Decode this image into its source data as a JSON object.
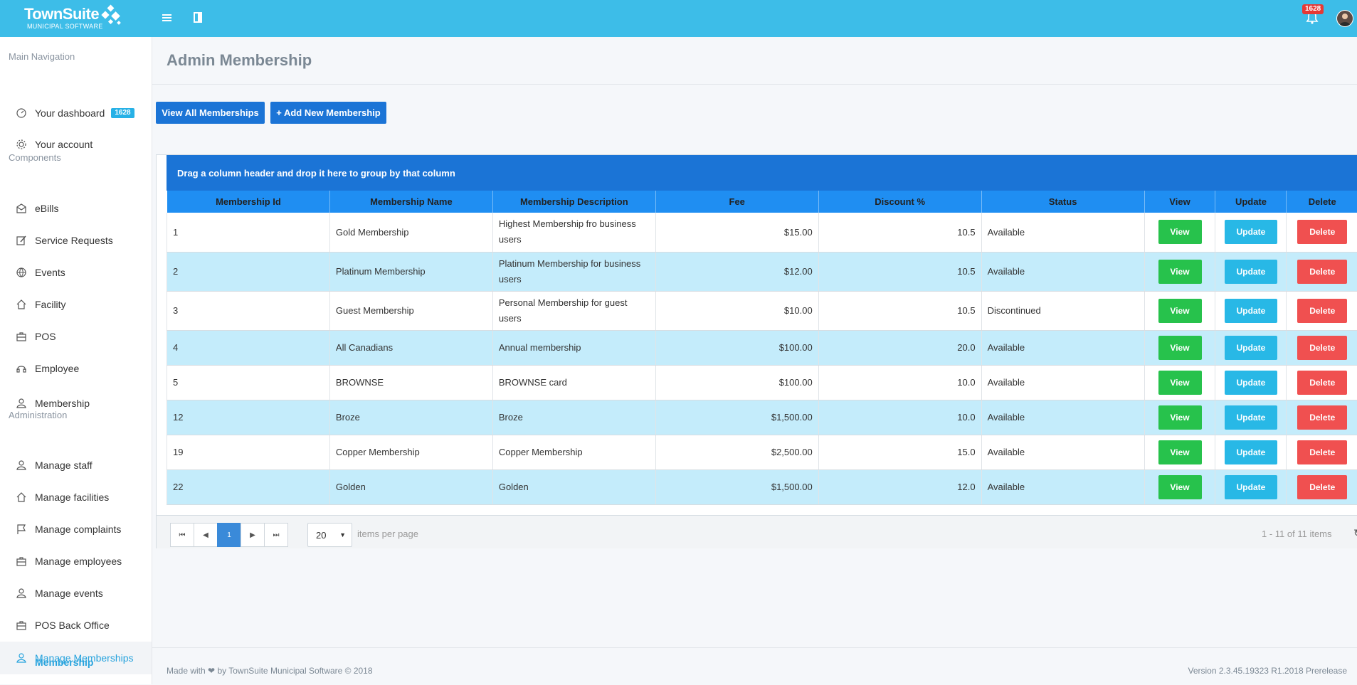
{
  "app": {
    "logo_name": "TownSuite",
    "logo_sub": "MUNICIPAL SOFTWARE",
    "notification_count": "1628"
  },
  "sidebar": {
    "sections": {
      "main": "Main Navigation",
      "components": "Components",
      "administration": "Administration"
    },
    "items": {
      "dashboard": "Your dashboard",
      "dashboard_badge": "1628",
      "account": "Your account",
      "ebills": "eBills",
      "service_requests": "Service Requests",
      "events": "Events",
      "facility": "Facility",
      "pos": "POS",
      "employee": "Employee",
      "membership": "Membership",
      "manage_staff": "Manage staff",
      "manage_facilities": "Manage facilities",
      "manage_complaints": "Manage complaints",
      "manage_employees": "Manage employees",
      "manage_events": "Manage events",
      "pos_back_office": "POS Back Office",
      "manage_memberships": "Manage Memberships",
      "sub_membership": "Membership"
    }
  },
  "page": {
    "title": "Admin Membership",
    "view_all_label": "View All Memberships",
    "add_new_label": "+ Add New Membership"
  },
  "grid": {
    "group_hint": "Drag a column header and drop it here to group by that column",
    "columns": [
      "Membership Id",
      "Membership Name",
      "Membership Description",
      "Fee",
      "Discount %",
      "Status",
      "View",
      "Update",
      "Delete"
    ],
    "rows": [
      {
        "id": "1",
        "name": "Gold Membership",
        "desc": "Highest Membership fro business users",
        "fee": "$15.00",
        "discount": "10.5",
        "status": "Available"
      },
      {
        "id": "2",
        "name": "Platinum Membership",
        "desc": "Platinum Membership for business users",
        "fee": "$12.00",
        "discount": "10.5",
        "status": "Available"
      },
      {
        "id": "3",
        "name": "Guest Membership",
        "desc": "Personal Membership for guest users",
        "fee": "$10.00",
        "discount": "10.5",
        "status": "Discontinued"
      },
      {
        "id": "4",
        "name": "All Canadians",
        "desc": "Annual membership",
        "fee": "$100.00",
        "discount": "20.0",
        "status": "Available"
      },
      {
        "id": "5",
        "name": "BROWNSE",
        "desc": "BROWNSE card",
        "fee": "$100.00",
        "discount": "10.0",
        "status": "Available"
      },
      {
        "id": "12",
        "name": "Broze",
        "desc": "Broze",
        "fee": "$1,500.00",
        "discount": "10.0",
        "status": "Available"
      },
      {
        "id": "19",
        "name": "Copper Membership",
        "desc": "Copper Membership",
        "fee": "$2,500.00",
        "discount": "15.0",
        "status": "Available"
      },
      {
        "id": "22",
        "name": "Golden",
        "desc": "Golden",
        "fee": "$1,500.00",
        "discount": "12.0",
        "status": "Available"
      }
    ],
    "view_label": "View",
    "update_label": "Update",
    "delete_label": "Delete"
  },
  "pager": {
    "current_page": "1",
    "page_size": "20",
    "per_page_label": "items per page",
    "info": "1 - 11 of 11 items"
  },
  "footer": {
    "made_with": "Made with",
    "made_by": "by TownSuite Municipal Software © 2018",
    "version": "Version 2.3.45.19323 R1.2018 Prerelease"
  },
  "colors": {
    "topbar": "#3dbde8",
    "primary_button": "#1b74d6",
    "header_row": "#1f8ef2",
    "alt_row": "#c4ecfb",
    "view": "#27c24c",
    "update": "#28b8e6",
    "delete": "#f05050",
    "active_nav": "#27a3dd"
  }
}
